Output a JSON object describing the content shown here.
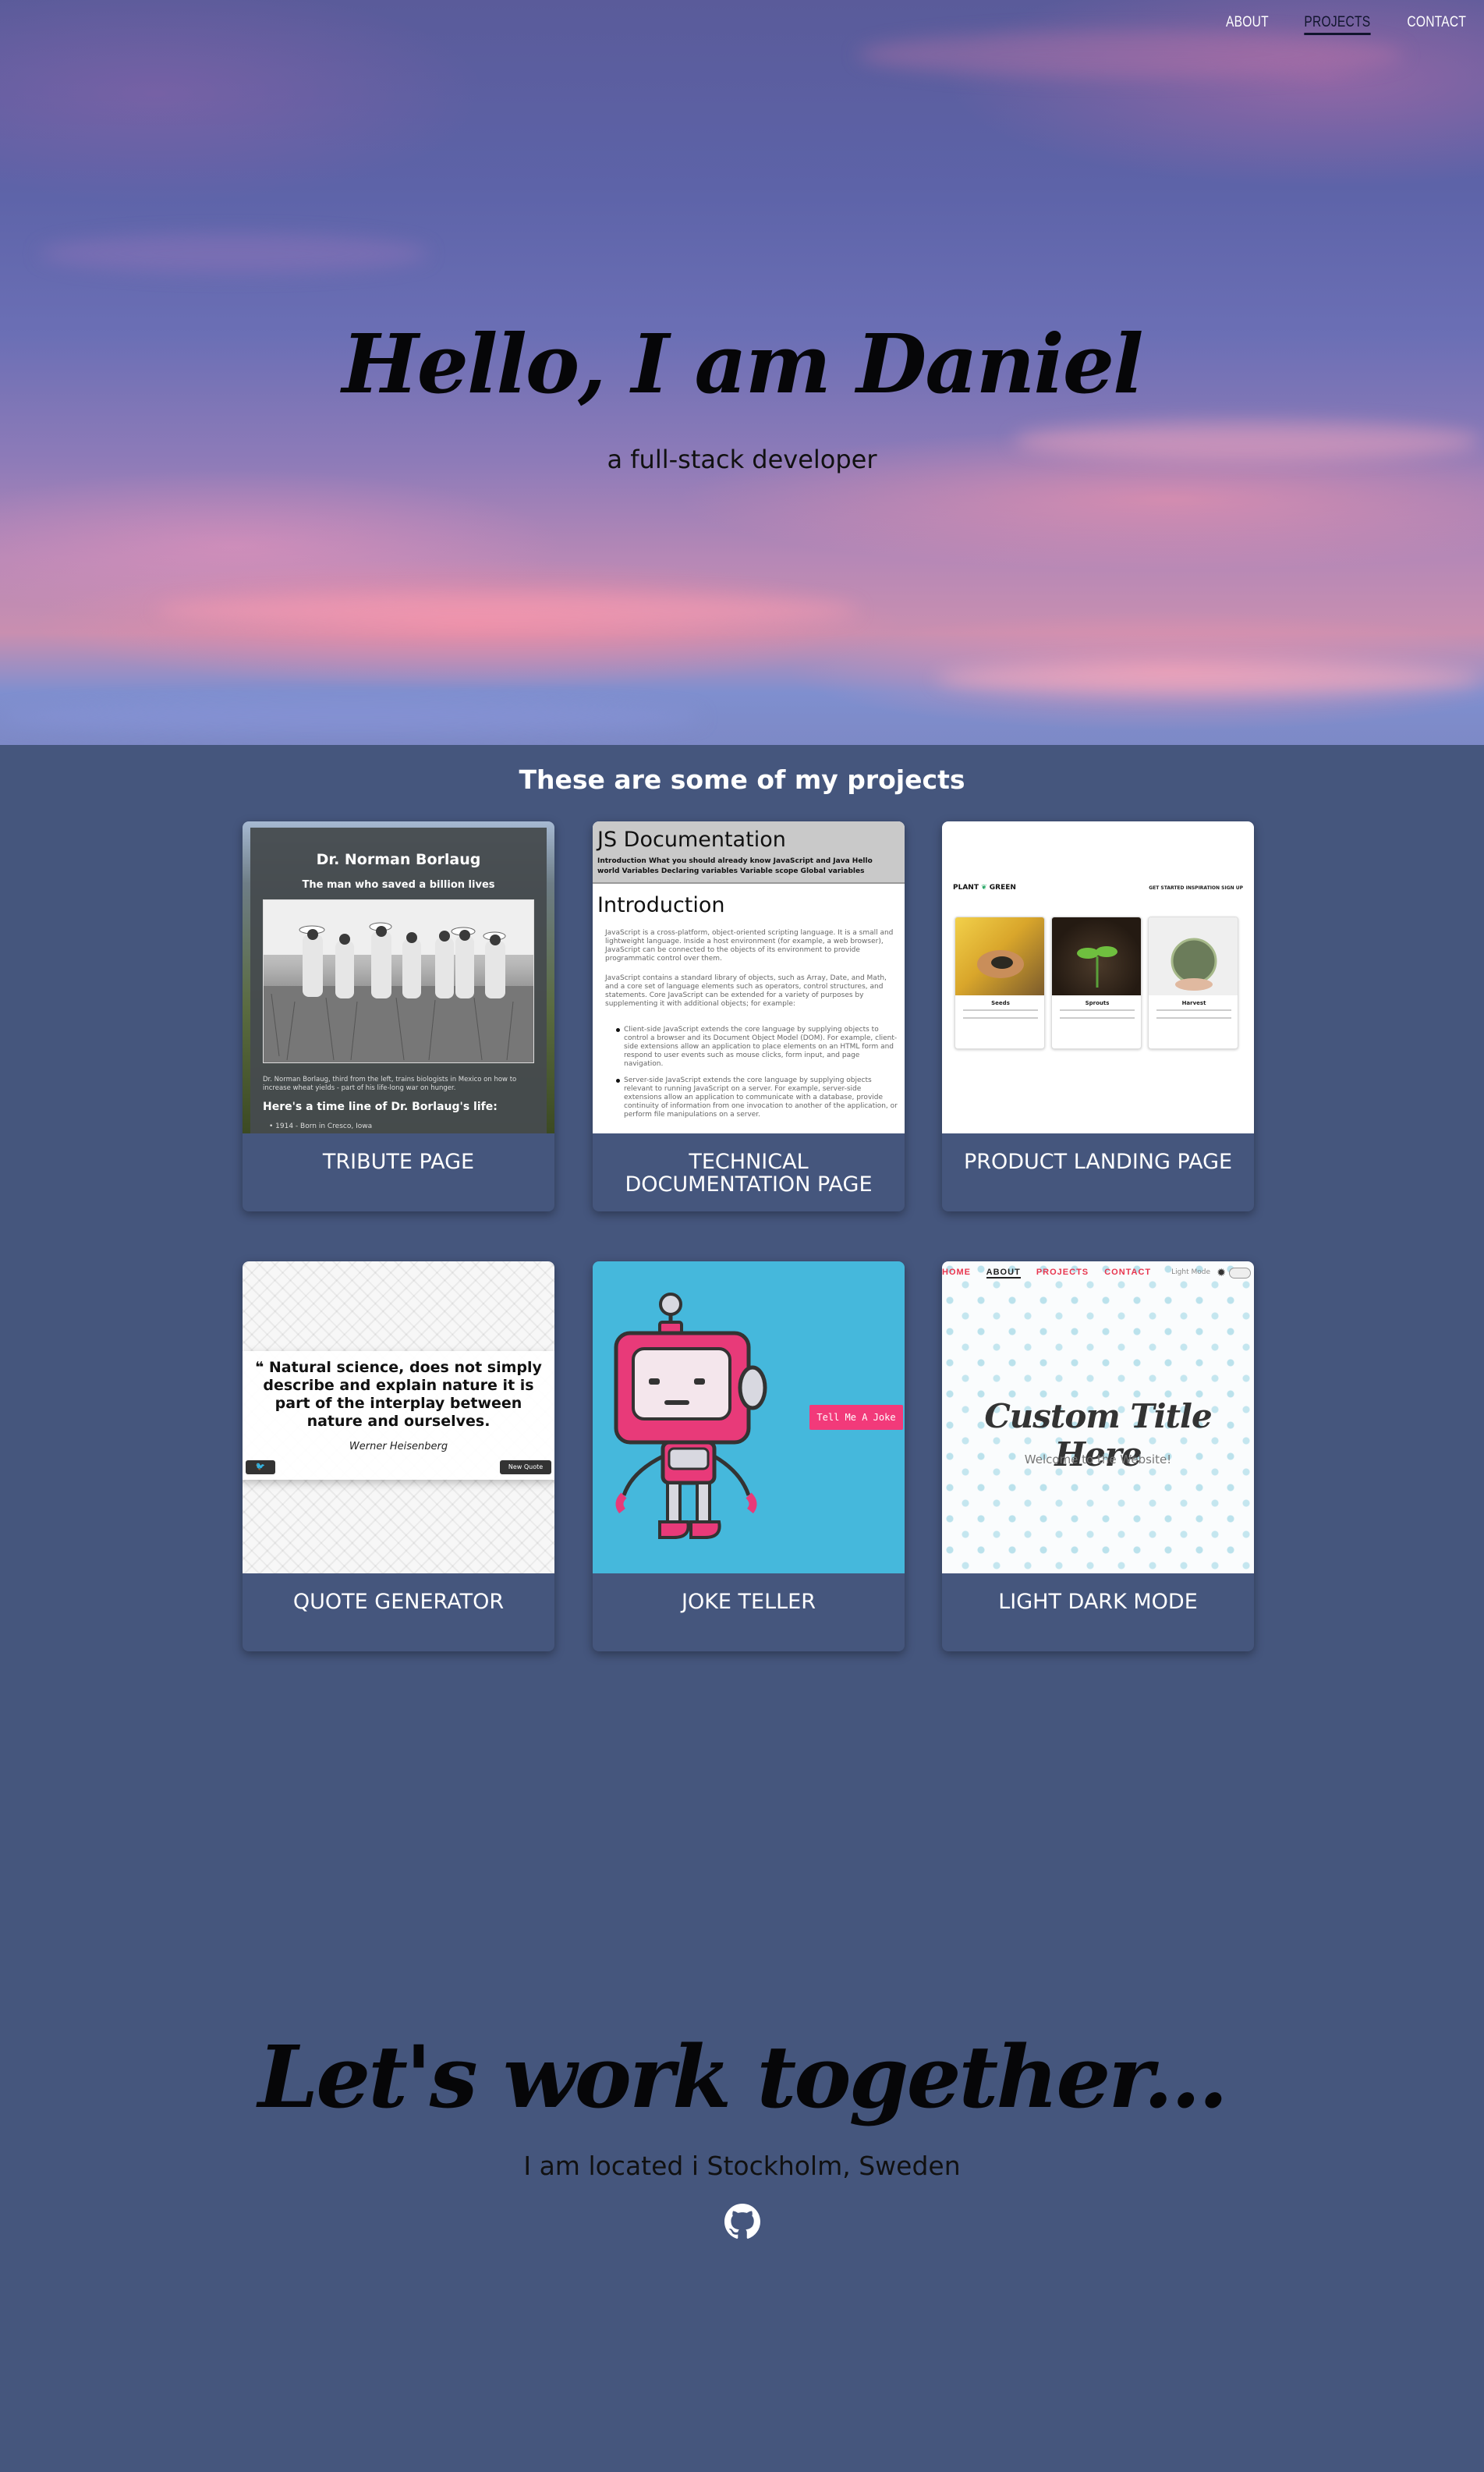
{
  "nav": {
    "items": [
      "ABOUT",
      "PROJECTS",
      "CONTACT"
    ]
  },
  "hero": {
    "title": "Hello, I am Daniel",
    "subtitle": "a full-stack developer"
  },
  "projects": {
    "heading": "These are some of my projects",
    "cards": [
      {
        "label": "TRIBUTE PAGE"
      },
      {
        "label": "TECHNICAL DOCUMENTATION PAGE"
      },
      {
        "label": "PRODUCT LANDING PAGE"
      },
      {
        "label": "QUOTE GENERATOR"
      },
      {
        "label": "JOKE TELLER"
      },
      {
        "label": "LIGHT DARK MODE"
      }
    ],
    "tribute_thumb": {
      "title": "Dr. Norman Borlaug",
      "subtitle": "The man who saved a billion lives",
      "caption": "Dr. Norman Borlaug, third from the left, trains biologists in Mexico on how to increase wheat yields - part of his life-long war on hunger.",
      "timeline_heading": "Here's a time line of Dr. Borlaug's life:",
      "first_item": "1914 - Born in Cresco, Iowa"
    },
    "docs_thumb": {
      "header": "JS Documentation",
      "nav_row1": "Introduction    What you should already know    JavaScript and Java    Hello",
      "nav_row2": "world    Variables    Declaring variables    Variable scope    Global variables",
      "section": "Introduction",
      "p1": "JavaScript is a cross-platform, object-oriented scripting language. It is a small and lightweight language. Inside a host environment (for example, a web browser), JavaScript can be connected to the objects of its environment to provide programmatic control over them.",
      "p2": "JavaScript contains a standard library of objects, such as Array, Date, and Math, and a core set of language elements such as operators, control structures, and statements. Core JavaScript can be extended for a variety of purposes by supplementing it with additional objects; for example:",
      "b1": "Client-side JavaScript extends the core language by supplying objects to control a browser and its Document Object Model (DOM). For example, client-side extensions allow an application to place elements on an HTML form and respond to user events such as mouse clicks, form input, and page navigation.",
      "b2": "Server-side JavaScript extends the core language by supplying objects relevant to running JavaScript on a server. For example, server-side extensions allow an application to communicate with a database, provide continuity of information from one invocation to another of the application, or perform file manipulations on a server."
    },
    "product_thumb": {
      "logo_left": "PLANT",
      "logo_right": "GREEN",
      "links": "GET STARTED    INSPIRATION    SIGN UP",
      "cards": [
        "Seeds",
        "Sprouts",
        "Harvest"
      ]
    },
    "quote_thumb": {
      "quote": "Natural science, does not simply describe and explain nature it is part of the interplay between nature and ourselves.",
      "author": "Werner Heisenberg",
      "tweet_icon": "twitter-icon",
      "new_quote": "New Quote"
    },
    "joke_thumb": {
      "button": "Tell Me A Joke"
    },
    "lightdark_thumb": {
      "menu": [
        "HOME",
        "ABOUT",
        "PROJECTS",
        "CONTACT"
      ],
      "mode_label": "Light Mode",
      "title": "Custom Title Here",
      "welcome": "Welcome to the Website!"
    }
  },
  "contact": {
    "title": "Let's work together...",
    "location": "I am located i Stockholm, Sweden",
    "github_icon": "github-icon"
  },
  "colors": {
    "page_bg": "#45567d",
    "active_nav": "#11152d",
    "joke_bg": "#45b8dc",
    "joke_button": "#f23a7a",
    "lightdark_accent": "#e8364f"
  }
}
